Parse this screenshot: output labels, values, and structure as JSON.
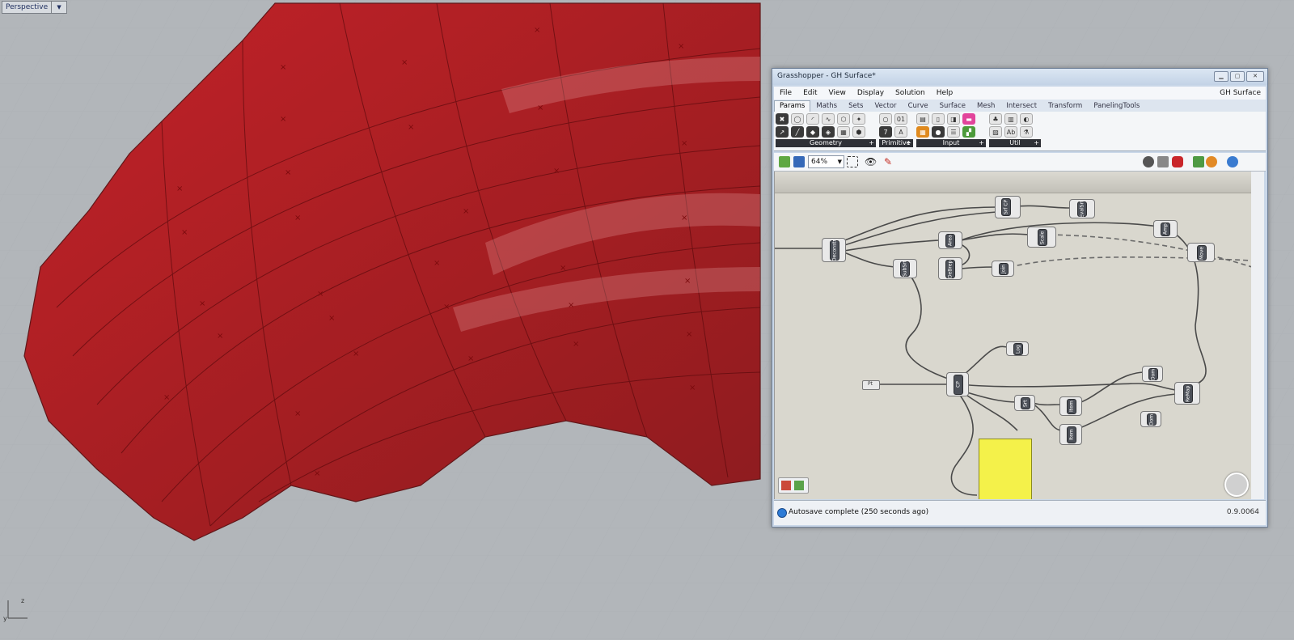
{
  "viewport": {
    "label": "Perspective",
    "axis_y": "y",
    "axis_z": "z"
  },
  "window": {
    "title": "Grasshopper - GH Surface*",
    "doc_name": "GH Surface",
    "menu": [
      "File",
      "Edit",
      "View",
      "Display",
      "Solution",
      "Help"
    ],
    "tabs": [
      "Params",
      "Maths",
      "Sets",
      "Vector",
      "Curve",
      "Surface",
      "Mesh",
      "Intersect",
      "Transform",
      "PanelingTools"
    ],
    "active_tab": "Params",
    "ribbon_groups": [
      "Geometry",
      "Primitive",
      "Input",
      "Util"
    ],
    "zoom": "64%",
    "status_text": "Autosave complete (250 seconds ago)",
    "version": "0.9.0064"
  },
  "canvas_components": [
    "Srf CP",
    "EvalSrf",
    "Area",
    "Scale",
    "Amp",
    "Move",
    "Deconstr",
    "SubSrf",
    "DeBrep",
    "Join",
    "Log",
    "CP",
    "Srt",
    "Item",
    "Item",
    "Dom",
    "Dom",
    "ReMap",
    "Pt"
  ]
}
